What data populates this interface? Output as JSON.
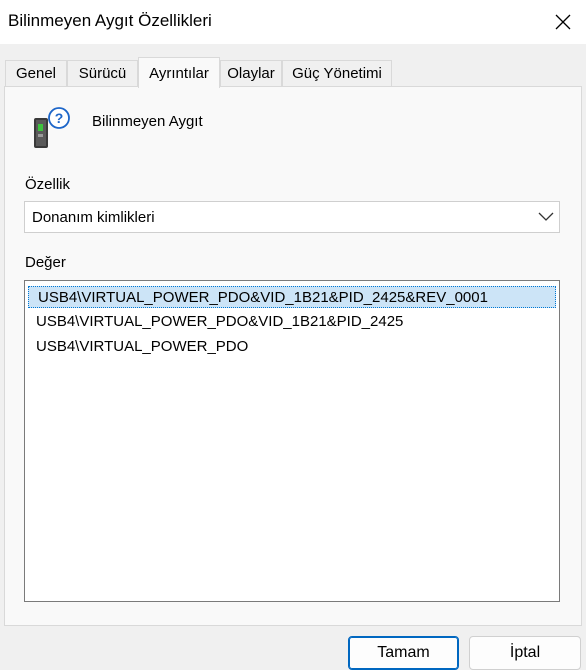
{
  "window": {
    "title": "Bilinmeyen Aygıt Özellikleri",
    "close_icon": "close-icon"
  },
  "tabs": [
    {
      "label": "Genel"
    },
    {
      "label": "Sürücü"
    },
    {
      "label": "Ayrıntılar",
      "active": true
    },
    {
      "label": "Olaylar"
    },
    {
      "label": "Güç Yönetimi"
    }
  ],
  "device": {
    "icon": "unknown-device-icon",
    "name": "Bilinmeyen Aygıt"
  },
  "property": {
    "label": "Özellik",
    "selected": "Donanım kimlikleri"
  },
  "value": {
    "label": "Değer",
    "items": [
      "USB4\\VIRTUAL_POWER_PDO&VID_1B21&PID_2425&REV_0001",
      "USB4\\VIRTUAL_POWER_PDO&VID_1B21&PID_2425",
      "USB4\\VIRTUAL_POWER_PDO"
    ],
    "selected_index": 0
  },
  "buttons": {
    "ok": "Tamam",
    "cancel": "İptal"
  },
  "colors": {
    "selection_bg": "#cce4f7",
    "accent": "#0067c0"
  }
}
